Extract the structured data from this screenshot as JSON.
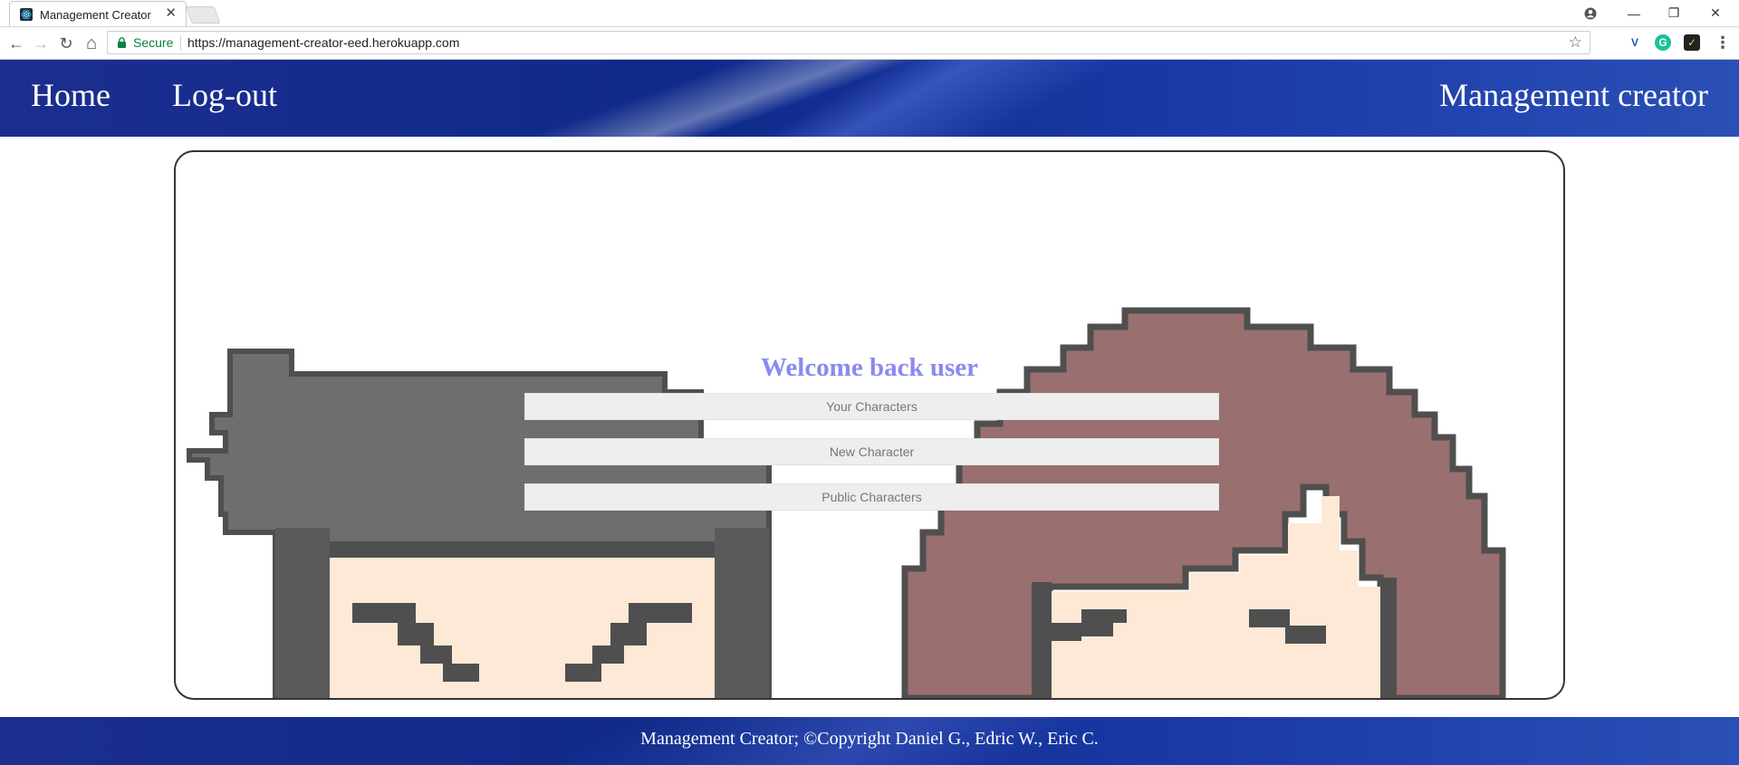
{
  "browser": {
    "tab_title": "Management Creator",
    "tab_close": "✕",
    "secure_label": "Secure",
    "url": "https://management-creator-eed.herokuapp.com",
    "window_controls": {
      "minimize": "—",
      "restore": "❐",
      "close": "✕"
    },
    "nav_icons": {
      "back": "←",
      "forward": "→",
      "reload": "↻",
      "home": "⌂"
    },
    "star": "☆",
    "extensions": [
      "V",
      "G",
      "✓"
    ],
    "menu": "⋮"
  },
  "header": {
    "nav": [
      {
        "label": "Home"
      },
      {
        "label": "Log-out"
      }
    ],
    "brand": "Management creator"
  },
  "main": {
    "welcome": "Welcome back user",
    "buttons": [
      {
        "label": "Your Characters"
      },
      {
        "label": "New Character"
      },
      {
        "label": "Public Characters"
      }
    ]
  },
  "footer": {
    "text": "Management Creator; ©Copyright Daniel G., Edric W., Eric C."
  },
  "colors": {
    "header_blue": "#0f2a8a",
    "welcome_text": "#8a89f0",
    "button_bg": "#eeeeee",
    "secure_green": "#0b8043",
    "hair_gray": "#6e6e6e",
    "hair_brown": "#9a6f6f",
    "skin": "#fde9d6",
    "outline": "#4f4f4f"
  }
}
